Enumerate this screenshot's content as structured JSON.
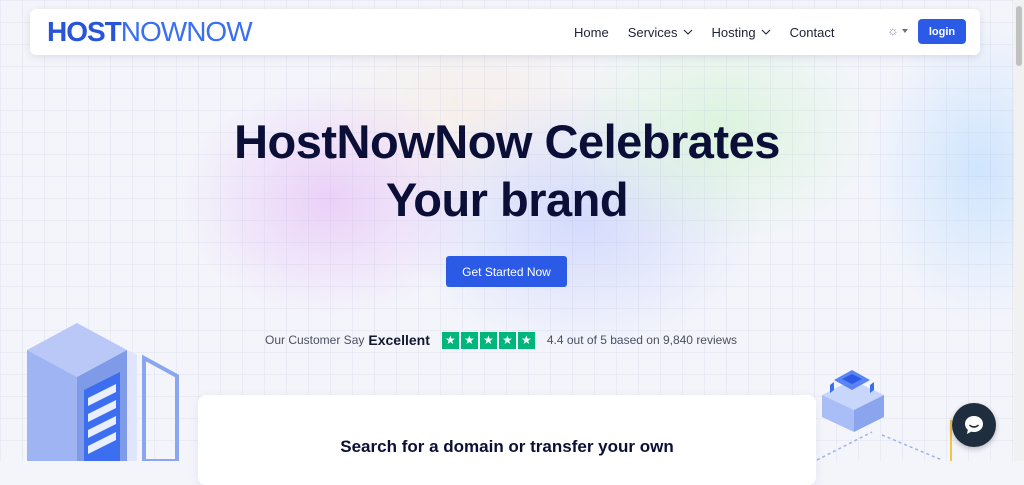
{
  "navbar": {
    "logo_part1": "HOST",
    "logo_part2": "NOWNOW",
    "links": [
      "Home",
      "Services",
      "Hosting",
      "Contact"
    ],
    "theme_toggle_icon": "sun-icon",
    "login_label": "login"
  },
  "hero": {
    "title_line1": "HostNowNow Celebrates",
    "title_line2": "Your brand",
    "cta_label": "Get Started Now"
  },
  "rating": {
    "prefix": "Our Customer Say",
    "word": "Excellent",
    "stars": 5,
    "summary": "4.4 out of 5 based on 9,840 reviews"
  },
  "search": {
    "title": "Search for a domain or transfer your own"
  },
  "colors": {
    "brand": "#2b5be6",
    "heading": "#0b0f38",
    "trustpilot": "#00b67a",
    "chat": "#1f2e3e"
  }
}
